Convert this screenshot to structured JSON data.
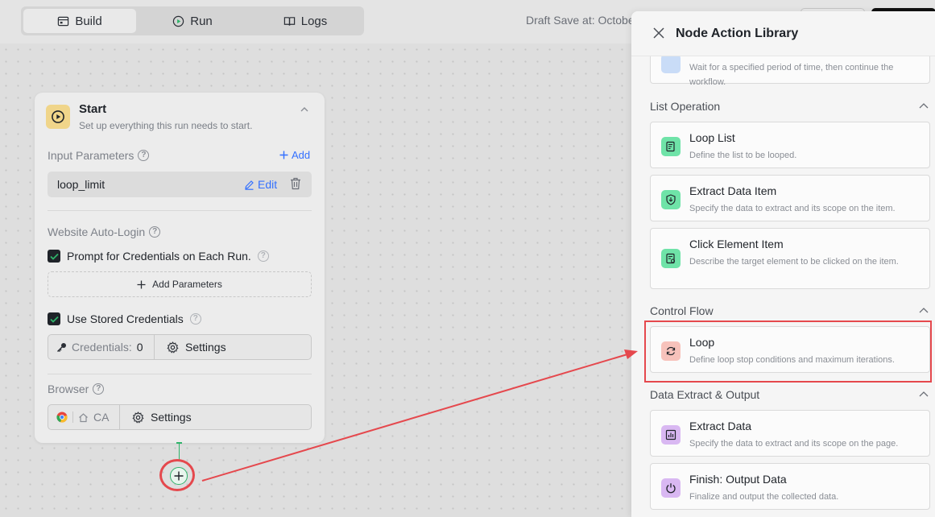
{
  "toolbar": {
    "tabs": [
      {
        "label": "Build",
        "icon": "build-icon",
        "active": true
      },
      {
        "label": "Run",
        "icon": "play-circle-icon",
        "active": false
      },
      {
        "label": "Logs",
        "icon": "book-icon",
        "active": false
      }
    ],
    "draft_save": "Draft Save at: October"
  },
  "start_node": {
    "title": "Start",
    "subtitle": "Set up everything this run needs to start.",
    "input_parameters": {
      "label": "Input Parameters",
      "add_label": "Add",
      "params": [
        {
          "name": "loop_limit",
          "edit_label": "Edit"
        }
      ]
    },
    "auto_login": {
      "label": "Website Auto-Login",
      "prompt_credentials": {
        "label": "Prompt for Credentials on Each Run.",
        "checked": true
      },
      "add_parameters_label": "Add Parameters",
      "stored_credentials": {
        "label": "Use Stored Credentials",
        "checked": true
      },
      "credentials_label": "Credentials:",
      "credentials_count": "0",
      "settings_label": "Settings"
    },
    "browser": {
      "label": "Browser",
      "region": "CA",
      "settings_label": "Settings"
    }
  },
  "library": {
    "title": "Node Action Library",
    "partial_item": {
      "desc": "Wait for a specified period of time, then continue the workflow."
    },
    "groups": [
      {
        "label": "List Operation",
        "items": [
          {
            "title": "Loop List",
            "desc": "Define the list to be looped."
          },
          {
            "title": "Extract Data Item",
            "desc": "Specify the data to extract and its scope on the item."
          },
          {
            "title": "Click Element Item",
            "desc": "Describe the target element to be clicked on the item."
          }
        ]
      },
      {
        "label": "Control Flow",
        "items": [
          {
            "title": "Loop",
            "desc": "Define loop stop conditions and maximum iterations."
          }
        ]
      },
      {
        "label": "Data Extract & Output",
        "items": [
          {
            "title": "Extract Data",
            "desc": "Specify the data to extract and its scope on the page."
          },
          {
            "title": "Finish: Output Data",
            "desc": "Finalize and output the collected data."
          }
        ]
      }
    ]
  },
  "colors": {
    "accent": "#3370ff",
    "success": "#2fb36a",
    "annotation": "#e5484d",
    "start_icon_bg": "#f0d58a",
    "list_icon_bg": "#6fe3a8",
    "loop_icon_bg": "#f7c2bb",
    "output_icon_bg": "#d9b8f2"
  }
}
